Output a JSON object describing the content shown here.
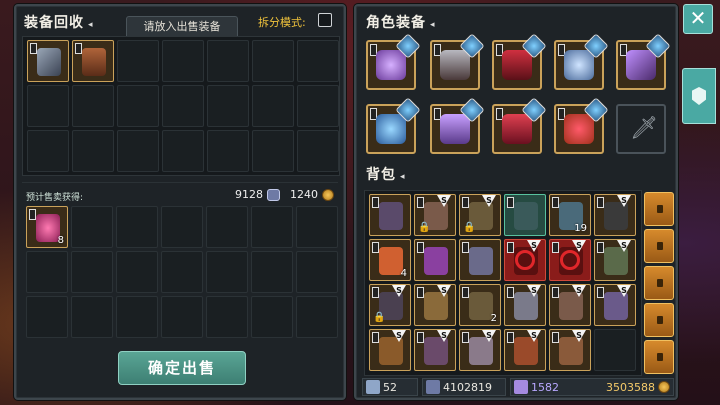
{
  "recycle": {
    "title": "装备回收",
    "hint_tab": "请放入出售装备",
    "split_mode_label": "拆分模式:",
    "estimate_label": "预计售卖获得:",
    "estimate_soul": "9128",
    "estimate_gold": "1240",
    "sell_button": "确定出售",
    "sell_slots": [
      {
        "filled": true,
        "art": "spear"
      },
      {
        "filled": true,
        "art": "boots"
      }
    ],
    "reward_slots": [
      {
        "filled": true,
        "art": "gem",
        "count": "8"
      }
    ]
  },
  "character": {
    "title": "角色装备",
    "equip": [
      {
        "art": "helmet-purple"
      },
      {
        "art": "armor-grey"
      },
      {
        "art": "cloak-red"
      },
      {
        "art": "ring-blue"
      },
      {
        "art": "staff-purple"
      },
      {
        "art": "crystal-blue"
      },
      {
        "art": "glove-purple"
      },
      {
        "art": "boots-red"
      },
      {
        "art": "ring-red"
      },
      {
        "art": "sword-empty"
      }
    ]
  },
  "bag": {
    "title": "背包",
    "items": [
      {
        "style": "filled",
        "count": ""
      },
      {
        "style": "filled",
        "lock": true,
        "s": true
      },
      {
        "style": "filled",
        "lock": true,
        "s": true
      },
      {
        "style": "green",
        "count": ""
      },
      {
        "style": "filled",
        "count": "19"
      },
      {
        "style": "filled",
        "s": true
      },
      {
        "style": "filled",
        "count": "4"
      },
      {
        "style": "filled"
      },
      {
        "style": "filled"
      },
      {
        "style": "red",
        "ring": true,
        "s": true
      },
      {
        "style": "red",
        "ring": true,
        "s": true
      },
      {
        "style": "filled",
        "s": true
      },
      {
        "style": "filled",
        "lock": true,
        "s": true
      },
      {
        "style": "filled",
        "s": true
      },
      {
        "style": "filled",
        "count": "2"
      },
      {
        "style": "filled",
        "s": true
      },
      {
        "style": "filled",
        "s": true
      },
      {
        "style": "filled",
        "s": true
      },
      {
        "style": "filled",
        "s": true
      },
      {
        "style": "filled",
        "s": true
      },
      {
        "style": "filled",
        "s": true
      },
      {
        "style": "filled",
        "s": true
      },
      {
        "style": "filled",
        "s": true
      },
      {
        "style": "empty"
      }
    ]
  },
  "stats": {
    "weapon_level": "52",
    "soul": "4102819",
    "crystal": "1582",
    "gold": "3503588"
  },
  "icons": {
    "close": "close-icon",
    "side": "equipment-tab-icon"
  }
}
